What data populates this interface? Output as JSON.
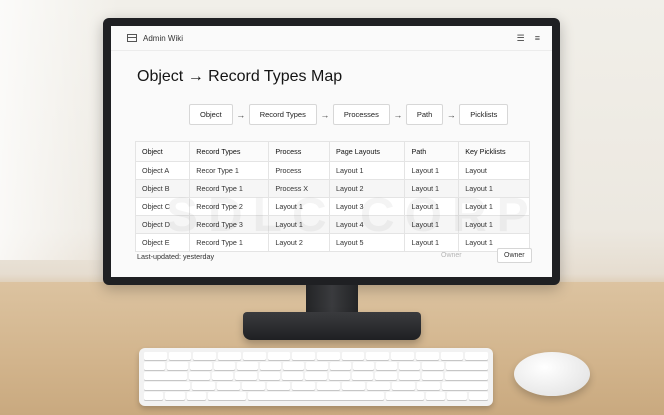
{
  "app": {
    "title": "Admin Wiki",
    "icons": [
      "app-icon",
      "menu-lines-icon",
      "hamburger-icon"
    ]
  },
  "page": {
    "title": "Object → Record Types Map"
  },
  "flow": {
    "steps": [
      "Object",
      "Record Types",
      "Processes",
      "Path",
      "Picklists"
    ],
    "arrow": "→"
  },
  "table": {
    "headers": [
      "Object",
      "Record Types",
      "Process",
      "Page Layouts",
      "Path",
      "Key Picklists"
    ],
    "rows": [
      [
        "Object A",
        "Recor Type 1",
        "Process",
        "Layout 1",
        "Layout 1",
        "Layout"
      ],
      [
        "Object B",
        "Record Type 1",
        "Process X",
        "Layout 2",
        "Layout 1",
        "Layout 1"
      ],
      [
        "Object C",
        "Record Type 2",
        "Layout 1",
        "Layout 3",
        "Layout 1",
        "Layout 1"
      ],
      [
        "Object D",
        "Record Type 3",
        "Layout 1",
        "Layout 4",
        "Layout 1",
        "Layout 1"
      ],
      [
        "Object E",
        "Record Type 1",
        "Layout 2",
        "Layout 5",
        "Layout 1",
        "Layout 1"
      ]
    ]
  },
  "footer": {
    "last_updated": "Last-updated: yesterday",
    "ghost_label": "Owner",
    "owner_button": "Owner"
  },
  "watermark": "SDLC CORP"
}
